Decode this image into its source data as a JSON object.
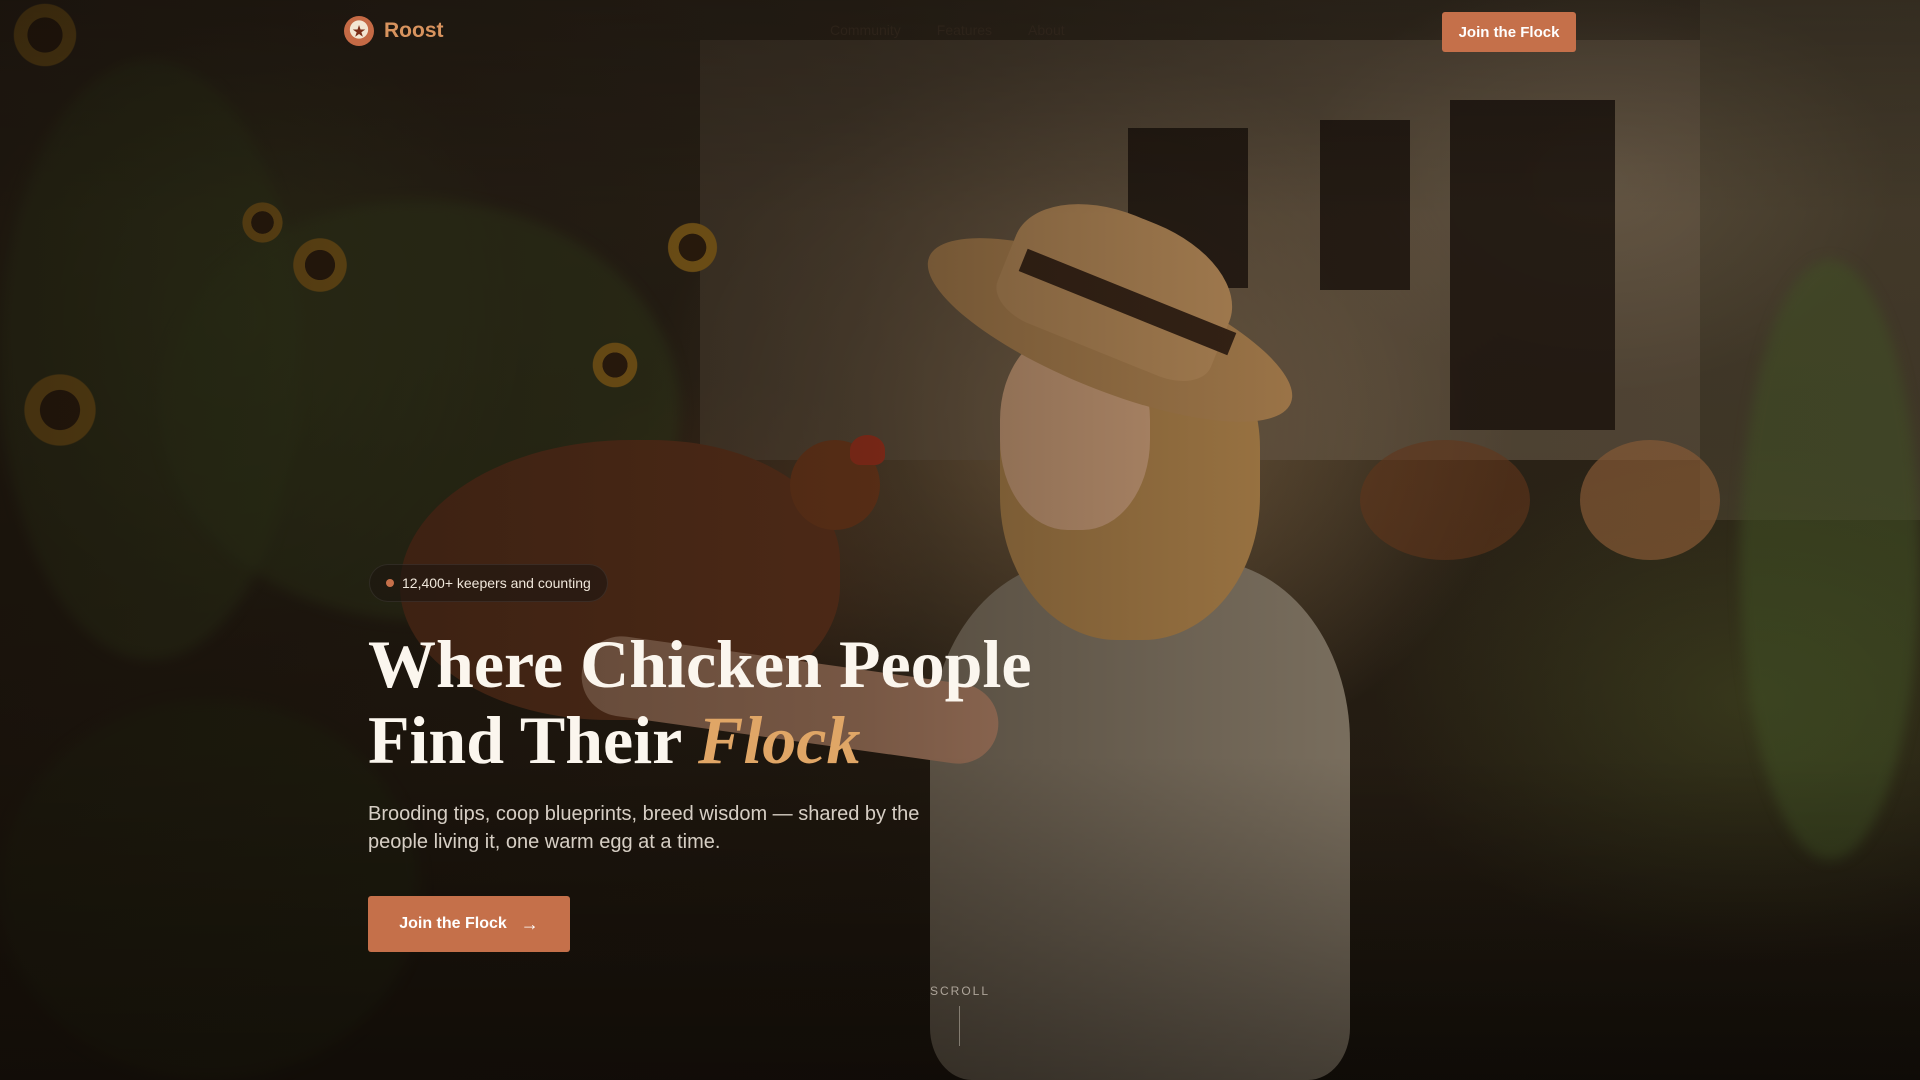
{
  "nav": {
    "brand": "Roost",
    "logo_icon": "rooster-emblem-icon",
    "links": [
      "Community",
      "Features",
      "About"
    ],
    "cta": "Join the Flock"
  },
  "hero": {
    "badge": "12,400+ keepers and counting",
    "headline_line1": "Where Chicken People",
    "headline_line2_plain": "Find Their ",
    "headline_line2_accent": "Flock",
    "subhead": "Brooding tips, coop blueprints, breed wisdom — shared by the people living it, one warm egg at a time.",
    "cta": "Join the Flock",
    "cta_icon": "arrow-right-icon",
    "scroll": "SCROLL"
  },
  "colors": {
    "accent": "#c5704a",
    "headline_accent": "#e0a666",
    "brand_text": "#d8935e"
  }
}
